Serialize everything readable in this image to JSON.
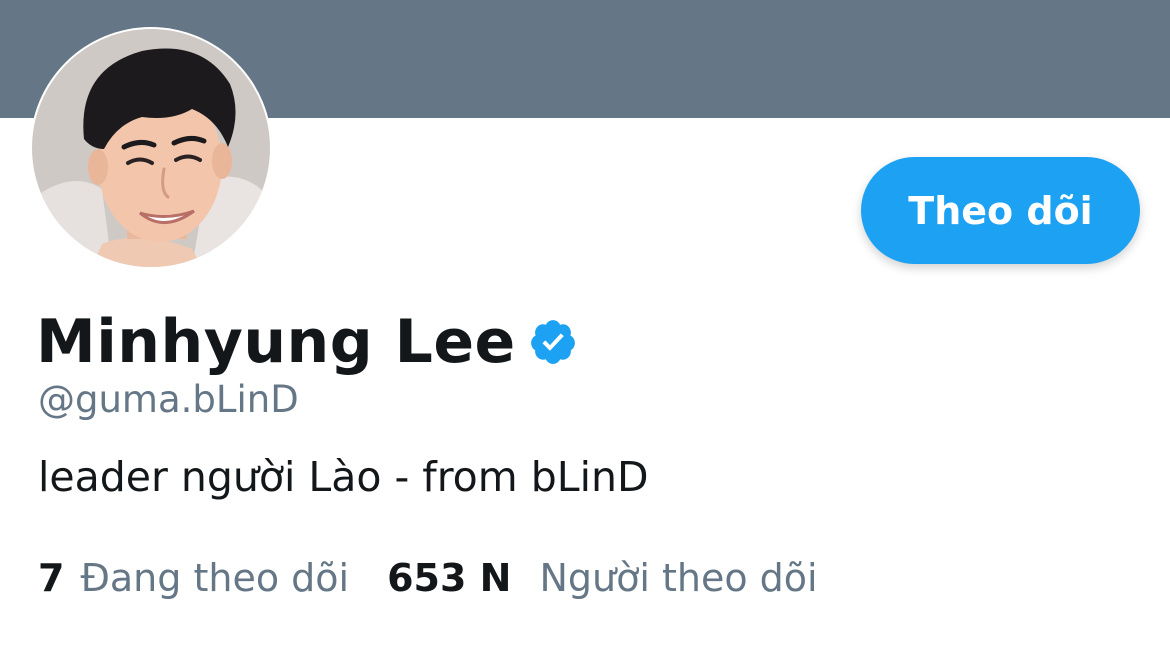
{
  "profile": {
    "display_name": "Minhyung Lee",
    "handle": "@guma.bLinD",
    "bio": "leader người Lào - from bLinD",
    "verified": true,
    "avatar_icon": "profile-photo"
  },
  "actions": {
    "follow_label": "Theo dõi"
  },
  "stats": {
    "following_count": "7",
    "following_label": "Đang theo dõi",
    "followers_count": "653 N",
    "followers_label": "Người theo dõi"
  },
  "colors": {
    "banner": "#657786",
    "accent": "#1da1f2",
    "text_primary": "#14171a",
    "text_secondary": "#657786"
  }
}
